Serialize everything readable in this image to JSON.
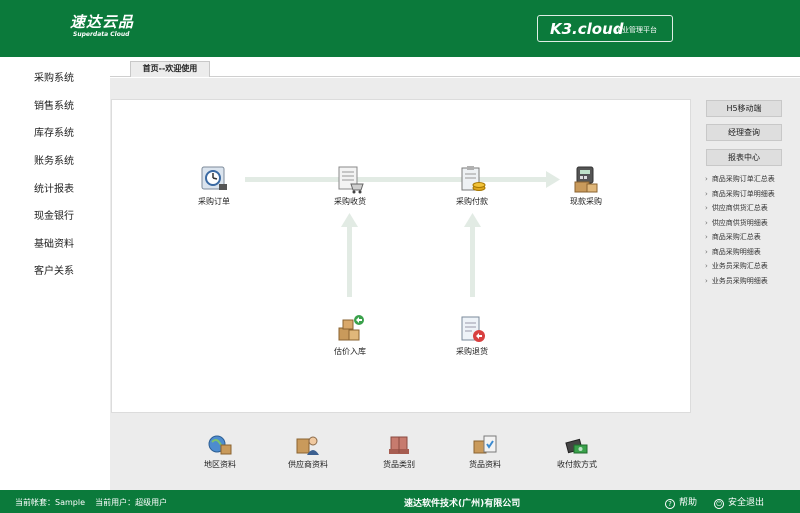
{
  "header": {
    "logo_main": "速达云品",
    "logo_sub": "Superdata Cloud",
    "product_name": "K3.cloud",
    "product_tagline": "企业管理平台"
  },
  "sidebar": {
    "items": [
      {
        "label": "采购系统"
      },
      {
        "label": "销售系统"
      },
      {
        "label": "库存系统"
      },
      {
        "label": "账务系统"
      },
      {
        "label": "统计报表"
      },
      {
        "label": "现金银行"
      },
      {
        "label": "基础资料"
      },
      {
        "label": "客户关系"
      }
    ]
  },
  "tabs": [
    {
      "label": "首页--欢迎使用"
    }
  ],
  "flow": {
    "nodes": [
      {
        "label": "采购订单",
        "icon": "purchase-order-icon"
      },
      {
        "label": "采购收货",
        "icon": "purchase-receipt-icon"
      },
      {
        "label": "采购付款",
        "icon": "purchase-payment-icon"
      },
      {
        "label": "现款采购",
        "icon": "cash-purchase-icon"
      },
      {
        "label": "估价入库",
        "icon": "estimated-stock-in-icon"
      },
      {
        "label": "采购退货",
        "icon": "purchase-return-icon"
      }
    ]
  },
  "right_panel": {
    "buttons": [
      {
        "label": "H5移动端"
      },
      {
        "label": "经理查询"
      },
      {
        "label": "报表中心"
      }
    ],
    "reports": [
      "商品采购订单汇总表",
      "商品采购订单明细表",
      "供应商供货汇总表",
      "供应商供货明细表",
      "商品采购汇总表",
      "商品采购明细表",
      "业务员采购汇总表",
      "业务员采购明细表"
    ]
  },
  "bottom": {
    "items": [
      {
        "label": "地区资料",
        "icon": "region-icon"
      },
      {
        "label": "供应商资料",
        "icon": "supplier-icon"
      },
      {
        "label": "货品类别",
        "icon": "goods-category-icon"
      },
      {
        "label": "货品资料",
        "icon": "goods-info-icon"
      },
      {
        "label": "收付款方式",
        "icon": "payment-method-icon"
      }
    ]
  },
  "footer": {
    "account_label": "当前帐套：Sample",
    "user_label": "当前用户：超级用户",
    "company": "速达软件技术(广州)有限公司",
    "help": "帮助",
    "logout": "安全退出"
  },
  "colors": {
    "brand_green": "#0b7a3b",
    "arrow": "#e2ebe4",
    "panel_bg": "#ececec"
  }
}
